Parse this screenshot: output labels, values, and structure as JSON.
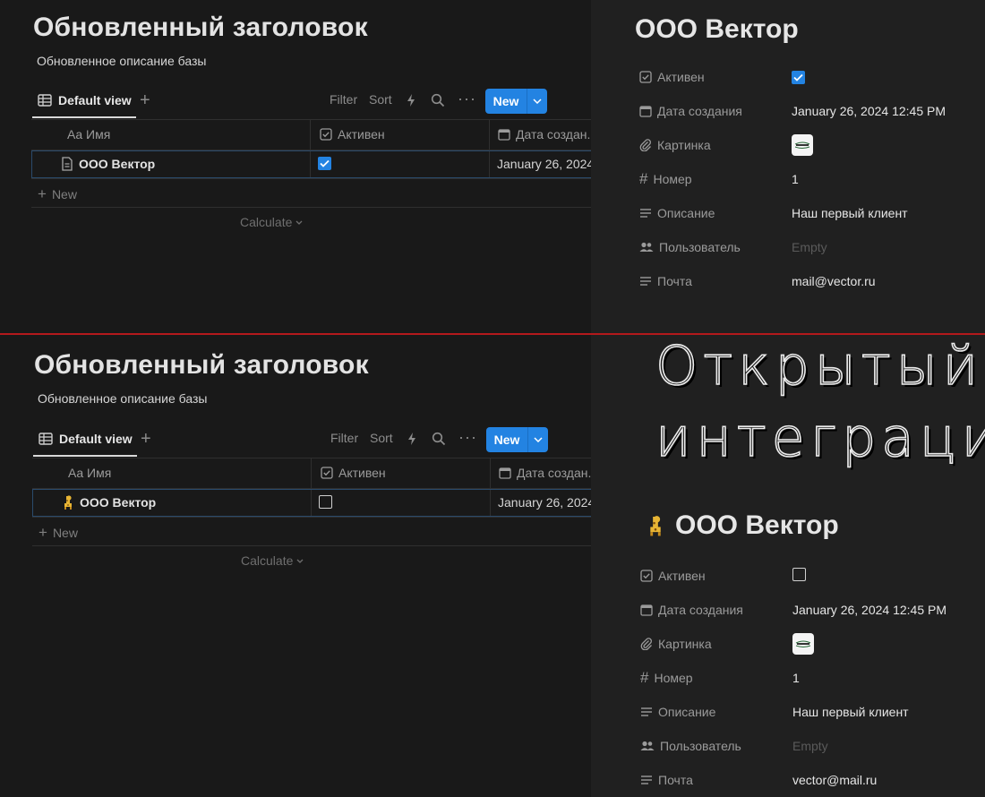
{
  "top": {
    "db_title": "Обновленный заголовок",
    "db_description": "Обновленное описание базы",
    "view_tab": "Default view",
    "toolbar": {
      "filter": "Filter",
      "sort": "Sort",
      "new": "New"
    },
    "columns": {
      "name": "Aa Имя",
      "active": "Активен",
      "date": "Дата создан..."
    },
    "row": {
      "name": "ООО Вектор",
      "active": true,
      "date": "January 26, 2024"
    },
    "add_row": "New",
    "calculate": "Calculate",
    "page": {
      "title": "ООО Вектор",
      "props": {
        "active_label": "Активен",
        "date_label": "Дата создания",
        "date_value": "January 26, 2024 12:45 PM",
        "image_label": "Картинка",
        "number_label": "Номер",
        "number_value": "1",
        "description_label": "Описание",
        "description_value": "Наш первый клиент",
        "user_label": "Пользователь",
        "user_value": "Empty",
        "mail_label": "Почта",
        "mail_value": "mail@vector.ru"
      }
    }
  },
  "bottom": {
    "db_title": "Обновленный заголовок",
    "db_description": "Обновленное описание базы",
    "view_tab": "Default view",
    "toolbar": {
      "filter": "Filter",
      "sort": "Sort",
      "new": "New"
    },
    "columns": {
      "name": "Aa Имя",
      "active": "Активен",
      "date": "Дата создан..."
    },
    "row": {
      "name": "ООО Вектор",
      "active": false,
      "date": "January 26, 2024",
      "icon": "giraffe-emoji-icon"
    },
    "add_row": "New",
    "calculate": "Calculate",
    "overlay_text": {
      "line1": "Открытый",
      "line2": "интеграци"
    },
    "page": {
      "title": "ООО Вектор",
      "props": {
        "active_label": "Активен",
        "date_label": "Дата создания",
        "date_value": "January 26, 2024 12:45 PM",
        "image_label": "Картинка",
        "number_label": "Номер",
        "number_value": "1",
        "description_label": "Описание",
        "description_value": "Наш первый клиент",
        "user_label": "Пользователь",
        "user_value": "Empty",
        "mail_label": "Почта",
        "mail_value": "vector@mail.ru"
      }
    }
  },
  "colors": {
    "accent": "#2383e2",
    "divider": "#b3191c",
    "background": "#191919",
    "side_panel": "#202020"
  }
}
